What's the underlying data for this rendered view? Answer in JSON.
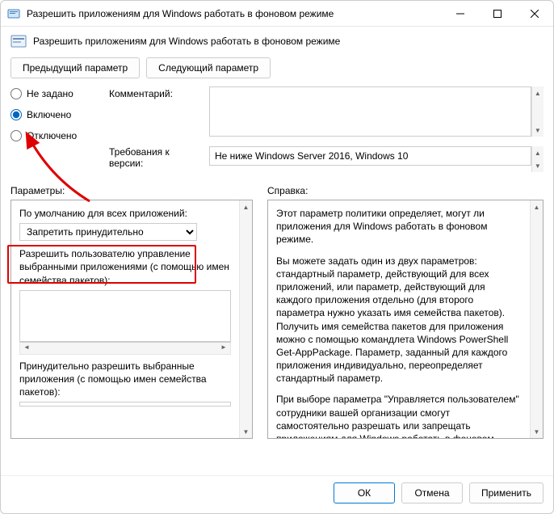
{
  "window": {
    "title": "Разрешить приложениям для Windows работать в фоновом режиме"
  },
  "header": {
    "title": "Разрешить приложениям для Windows работать в фоновом режиме"
  },
  "nav": {
    "prev": "Предыдущий параметр",
    "next": "Следующий параметр"
  },
  "state": {
    "not_configured": "Не задано",
    "enabled": "Включено",
    "disabled": "Отключено",
    "selected": "enabled"
  },
  "fields": {
    "comment_label": "Комментарий:",
    "comment_value": "",
    "requirements_label": "Требования к версии:",
    "requirements_value": "Не ниже Windows Server 2016, Windows 10"
  },
  "lower": {
    "params_label": "Параметры:",
    "help_label": "Справка:"
  },
  "params": {
    "default_label": "По умолчанию для всех приложений:",
    "default_value": "Запретить принудительно",
    "default_options": [
      "Запретить принудительно"
    ],
    "allow_user_label": "Разрешить пользователю управление выбранными приложениями (с помощью имен семейства пакетов):",
    "force_allow_label": "Принудительно разрешить выбранные приложения (с помощью имен семейства пакетов):"
  },
  "help": {
    "p1": "Этот параметр политики определяет, могут ли приложения для Windows работать в фоновом режиме.",
    "p2": "Вы можете задать один из двух параметров: стандартный параметр, действующий для всех приложений, или параметр, действующий для каждого приложения отдельно (для второго параметра нужно указать имя семейства пакетов). Получить имя семейства пакетов для приложения можно с помощью командлета Windows PowerShell Get-AppPackage. Параметр, заданный для каждого приложения индивидуально, переопределяет стандартный параметр.",
    "p3": "При выборе параметра \"Управляется пользователем\" сотрудники вашей организации смогут самостоятельно разрешать или запрещать приложениям для Windows работать в фоновом режиме. Для этого необходимо выбрать элементы \"Параметры\" > \"Конфиденциальность\" на устройстве."
  },
  "buttons": {
    "ok": "ОК",
    "cancel": "Отмена",
    "apply": "Применить"
  }
}
